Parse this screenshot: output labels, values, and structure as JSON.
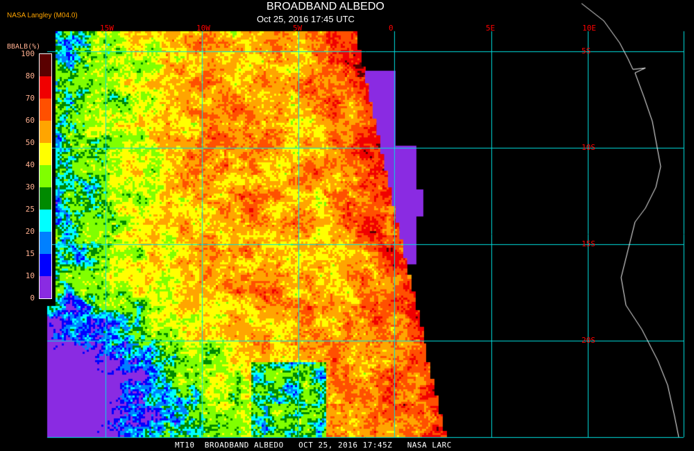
{
  "header": {
    "title": "BROADBAND ALBEDO",
    "subtitle": "Oct 25, 2016 17:45 UTC",
    "source": "NASA Langley (M04.0)"
  },
  "colorbar": {
    "title": "BBALB(%)",
    "labels": [
      "100",
      "80",
      "70",
      "60",
      "50",
      "40",
      "30",
      "25",
      "20",
      "15",
      "10",
      "0"
    ],
    "colors": [
      "#5a0000",
      "#f00000",
      "#ff5000",
      "#ffa500",
      "#ffff00",
      "#80ff00",
      "#008a00",
      "#00ffff",
      "#0080ff",
      "#0000ff",
      "#8a2be2"
    ]
  },
  "grid": {
    "longitudes": [
      "15W",
      "10W",
      "5W",
      "0",
      "5E",
      "10E"
    ],
    "latitudes": [
      "5S",
      "10S",
      "15S",
      "20S"
    ],
    "line_color": "#00e0e0",
    "label_color": "#ff0000"
  },
  "caption": "MT10  BROADBAND ALBEDO   OCT 25, 2016 17:45Z   NASA LARC"
}
